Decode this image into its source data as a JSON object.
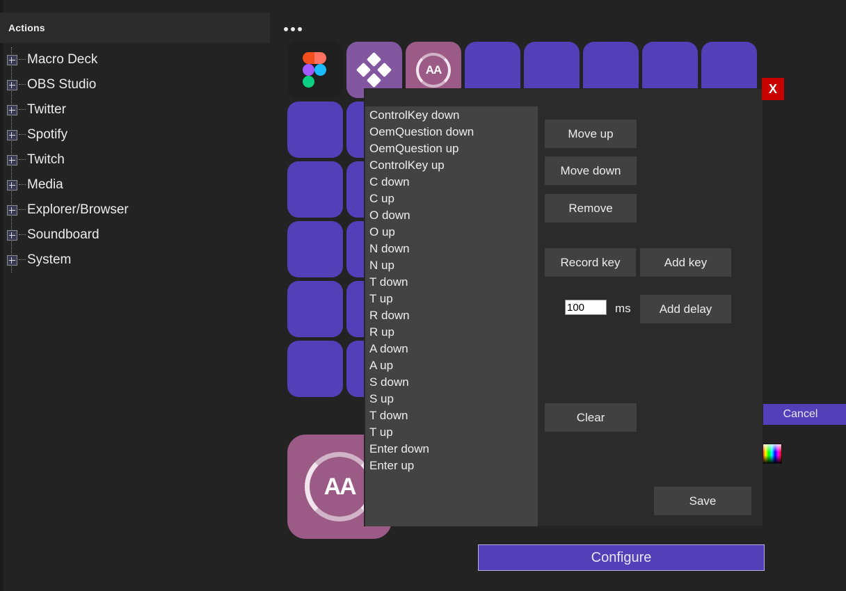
{
  "sidebar": {
    "header_title": "Actions",
    "items": [
      {
        "label": "Macro Deck"
      },
      {
        "label": "OBS Studio"
      },
      {
        "label": "Twitter"
      },
      {
        "label": "Spotify"
      },
      {
        "label": "Twitch"
      },
      {
        "label": "Media"
      },
      {
        "label": "Explorer/Browser"
      },
      {
        "label": "Soundboard"
      },
      {
        "label": "System"
      }
    ]
  },
  "deck": {
    "overflow_menu_icon": "ellipsis-icon",
    "columns": 8,
    "rows": 7,
    "colors": {
      "empty_button": "#5340b8",
      "dark_button": "#1f1f1f",
      "purple_lite_button": "#82579f",
      "pink_button": "#9c5a87"
    },
    "buttons": [
      {
        "icon": "figma-icon",
        "style": "dark"
      },
      {
        "icon": "diamonds-icon",
        "style": "purple-lite"
      },
      {
        "icon": "aa-circle-icon",
        "style": "pink"
      },
      {
        "icon": "",
        "style": "empty"
      },
      {
        "icon": "",
        "style": "empty"
      },
      {
        "icon": "",
        "style": "empty"
      },
      {
        "icon": "",
        "style": "empty"
      },
      {
        "icon": "",
        "style": "empty"
      }
    ],
    "preview_icon": "aa-circle-icon",
    "cancel_label": "Cancel",
    "configure_label": "Configure",
    "color_picker_icon": "color-swatch-icon"
  },
  "dialog": {
    "close_label": "X",
    "key_sequence": [
      "ControlKey down",
      "OemQuestion down",
      "OemQuestion up",
      "ControlKey up",
      "C down",
      "C up",
      "O down",
      "O up",
      "N down",
      "N up",
      "T down",
      "T up",
      "R down",
      "R up",
      "A down",
      "A up",
      "S down",
      "S up",
      "T down",
      "T up",
      "Enter down",
      "Enter up"
    ],
    "move_up_label": "Move up",
    "move_down_label": "Move down",
    "remove_label": "Remove",
    "record_key_label": "Record key",
    "add_key_label": "Add key",
    "delay_value": "100",
    "delay_unit": "ms",
    "add_delay_label": "Add delay",
    "clear_label": "Clear",
    "save_label": "Save"
  }
}
